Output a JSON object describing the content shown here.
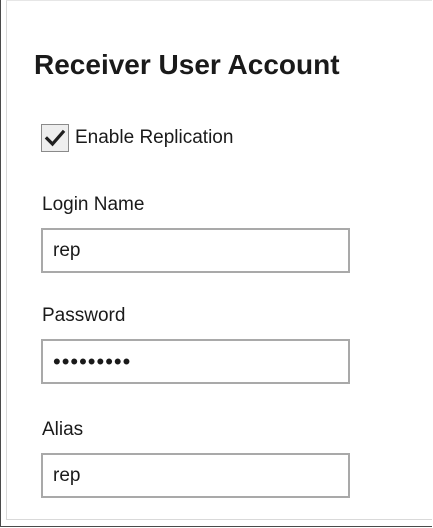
{
  "section": {
    "title": "Receiver User Account"
  },
  "replication": {
    "label": "Enable Replication",
    "checked": true
  },
  "fields": {
    "login_name": {
      "label": "Login Name",
      "value": "rep"
    },
    "password": {
      "label": "Password",
      "value": "•••••••••"
    },
    "alias": {
      "label": "Alias",
      "value": "rep"
    }
  },
  "icons": {
    "checkbox_mark": "checkmark-icon"
  }
}
